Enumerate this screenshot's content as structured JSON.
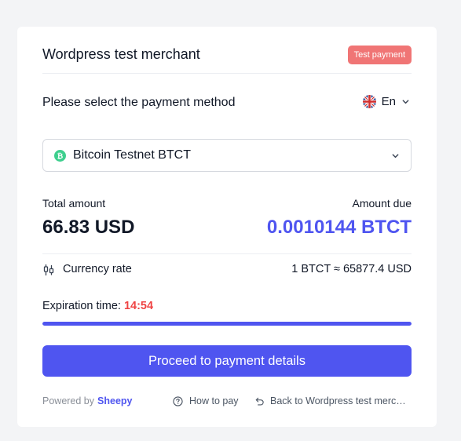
{
  "header": {
    "merchant_name": "Wordpress test merchant",
    "badge": "Test payment"
  },
  "payment": {
    "select_label": "Please select the payment method",
    "language": "En",
    "selected_coin": "Bitcoin Testnet BTCT"
  },
  "amounts": {
    "total_label": "Total amount",
    "total_value": "66.83 USD",
    "due_label": "Amount due",
    "due_value": "0.0010144 BTCT"
  },
  "rate": {
    "label": "Currency rate",
    "value": "1 BTCT ≈ 65877.4 USD"
  },
  "expiration": {
    "label": "Expiration time: ",
    "time": "14:54",
    "progress_percent": 100
  },
  "actions": {
    "proceed_label": "Proceed to payment details"
  },
  "footer": {
    "powered_by": "Powered by",
    "brand": "Sheepy",
    "how_to_pay": "How to pay",
    "back_link": "Back to Wordpress test merchant"
  },
  "colors": {
    "accent": "#4f55f0",
    "badge": "#f07575",
    "timer": "#ef4444",
    "coin_icon": "#3ecf8e"
  }
}
